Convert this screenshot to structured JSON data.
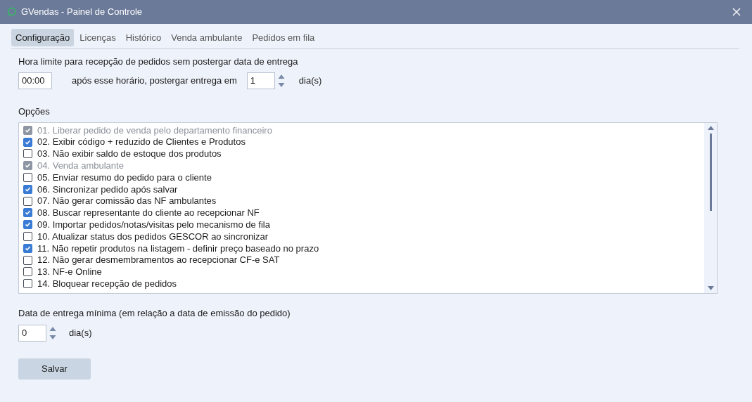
{
  "window": {
    "title": "GVendas - Painel de Controle"
  },
  "tabs": [
    {
      "label": "Configuração",
      "selected": true
    },
    {
      "label": "Licenças",
      "selected": false
    },
    {
      "label": "Histórico",
      "selected": false
    },
    {
      "label": "Venda ambulante",
      "selected": false
    },
    {
      "label": "Pedidos em fila",
      "selected": false
    }
  ],
  "cutoff": {
    "label": "Hora limite para recepção de pedidos sem postergar data de entrega",
    "time": "00:00",
    "middle_text": "após esse horário, postergar entrega em",
    "days": "1",
    "unit": "dia(s)"
  },
  "options": {
    "label": "Opções",
    "items": [
      {
        "label": "01. Liberar pedido de venda pelo departamento financeiro",
        "checked": true,
        "disabled": true
      },
      {
        "label": "02. Exibir código + reduzido de Clientes e Produtos",
        "checked": true,
        "disabled": false
      },
      {
        "label": "03. Não exibir saldo de estoque dos produtos",
        "checked": false,
        "disabled": false
      },
      {
        "label": "04. Venda ambulante",
        "checked": true,
        "disabled": true
      },
      {
        "label": "05. Enviar resumo do pedido para o cliente",
        "checked": false,
        "disabled": false
      },
      {
        "label": "06. Sincronizar pedido após salvar",
        "checked": true,
        "disabled": false
      },
      {
        "label": "07. Não gerar comissão das NF ambulantes",
        "checked": false,
        "disabled": false
      },
      {
        "label": "08. Buscar representante do cliente ao recepcionar NF",
        "checked": true,
        "disabled": false
      },
      {
        "label": "09. Importar pedidos/notas/visitas pelo mecanismo de fila",
        "checked": true,
        "disabled": false
      },
      {
        "label": "10. Atualizar status dos pedidos GESCOR ao sincronizar",
        "checked": false,
        "disabled": false
      },
      {
        "label": "11. Não repetir produtos na listagem - definir preço baseado no prazo",
        "checked": true,
        "disabled": false
      },
      {
        "label": "12. Não gerar desmembramentos ao recepcionar CF-e SAT",
        "checked": false,
        "disabled": false
      },
      {
        "label": "13. NF-e Online",
        "checked": false,
        "disabled": false
      },
      {
        "label": "14. Bloquear recepção de pedidos",
        "checked": false,
        "disabled": false
      }
    ]
  },
  "min_delivery": {
    "label": "Data de entrega mínima (em relação a data de emissão do pedido)",
    "days": "0",
    "unit": "dia(s)"
  },
  "save_button": "Salvar"
}
